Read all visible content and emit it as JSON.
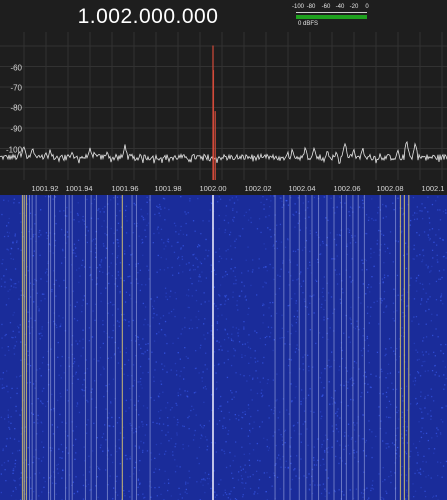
{
  "header": {
    "frequency": "1.002.000.000"
  },
  "level_meter": {
    "ticks": [
      "-100",
      "-80",
      "-60",
      "-40",
      "-20",
      "0"
    ],
    "unit": "0 dBFS",
    "level_fraction": 1.0,
    "bar_color": "#1fa11f"
  },
  "spectrum": {
    "y_labels": [
      "-60",
      "-70",
      "-80",
      "-90",
      "-100"
    ],
    "x_labels": [
      "1001.92",
      "1001.94",
      "1001.96",
      "1001.98",
      "1002.00",
      "1002.02",
      "1002.04",
      "1002.06",
      "1002.08",
      "1002.1"
    ],
    "trace_color": "#e8e8e8",
    "peak_color": "#d24a3a"
  },
  "chart_data": {
    "type": "line",
    "x_axis": "MHz",
    "xlim": [
      1001.91,
      1002.105
    ],
    "ylim": [
      -106,
      -50
    ],
    "series": [
      {
        "x": [
          1001.912,
          1001.914,
          1001.918,
          1001.924,
          1001.926,
          1001.934,
          1001.936,
          1001.944,
          1001.946,
          1001.952,
          1001.956,
          1001.96,
          1001.964,
          1001.972,
          1002.0,
          1002.0002,
          1002.001,
          1002.028,
          1002.034,
          1002.036,
          1002.042,
          1002.046,
          1002.052,
          1002.056,
          1002.06,
          1002.064,
          1002.068,
          1002.076,
          1002.084,
          1002.088,
          1002.092
        ],
        "y": [
          -100,
          -98,
          -99,
          -101,
          -100,
          -102,
          -101,
          -99,
          -101,
          -101,
          -102,
          -98,
          -103,
          -104,
          -50,
          -62,
          -82,
          -104,
          -101,
          -100,
          -99,
          -99,
          -100,
          -101,
          -97,
          -100,
          -99,
          -102,
          -100,
          -96,
          -97
        ]
      }
    ]
  },
  "waterfall": {
    "background_color": "#1a2c9a",
    "noise_color": "#3a5cf0",
    "carrier_color": "#f2f2ff",
    "strong_line_color": "#c7b773",
    "weak_line_color": "#b8c2ee",
    "lines": [
      {
        "f": 1001.9134,
        "kind": "strong"
      },
      {
        "f": 1001.9142,
        "kind": "strong"
      },
      {
        "f": 1001.9152,
        "kind": "strong"
      },
      {
        "f": 1001.9166,
        "kind": "weak"
      },
      {
        "f": 1001.9178,
        "kind": "weak"
      },
      {
        "f": 1001.9196,
        "kind": "weak"
      },
      {
        "f": 1001.9252,
        "kind": "weak"
      },
      {
        "f": 1001.9262,
        "kind": "weak"
      },
      {
        "f": 1001.928,
        "kind": "weak"
      },
      {
        "f": 1001.933,
        "kind": "weak"
      },
      {
        "f": 1001.9346,
        "kind": "weak"
      },
      {
        "f": 1001.936,
        "kind": "weak"
      },
      {
        "f": 1001.942,
        "kind": "weak"
      },
      {
        "f": 1001.9446,
        "kind": "weak"
      },
      {
        "f": 1001.947,
        "kind": "weak"
      },
      {
        "f": 1001.952,
        "kind": "weak"
      },
      {
        "f": 1001.9556,
        "kind": "weak"
      },
      {
        "f": 1001.9588,
        "kind": "strong"
      },
      {
        "f": 1001.9632,
        "kind": "weak"
      },
      {
        "f": 1001.9652,
        "kind": "weak"
      },
      {
        "f": 1001.9714,
        "kind": "weak"
      },
      {
        "f": 1002.0,
        "kind": "carrier"
      },
      {
        "f": 1002.0282,
        "kind": "weak"
      },
      {
        "f": 1002.0322,
        "kind": "weak"
      },
      {
        "f": 1002.035,
        "kind": "weak"
      },
      {
        "f": 1002.0392,
        "kind": "weak"
      },
      {
        "f": 1002.0422,
        "kind": "weak"
      },
      {
        "f": 1002.045,
        "kind": "weak"
      },
      {
        "f": 1002.048,
        "kind": "weak"
      },
      {
        "f": 1002.0518,
        "kind": "weak"
      },
      {
        "f": 1002.055,
        "kind": "weak"
      },
      {
        "f": 1002.0584,
        "kind": "weak"
      },
      {
        "f": 1002.0606,
        "kind": "weak"
      },
      {
        "f": 1002.0636,
        "kind": "weak"
      },
      {
        "f": 1002.066,
        "kind": "weak"
      },
      {
        "f": 1002.0688,
        "kind": "weak"
      },
      {
        "f": 1002.076,
        "kind": "weak"
      },
      {
        "f": 1002.083,
        "kind": "weak"
      },
      {
        "f": 1002.0852,
        "kind": "strong"
      },
      {
        "f": 1002.087,
        "kind": "strong"
      },
      {
        "f": 1002.089,
        "kind": "strong"
      }
    ]
  }
}
